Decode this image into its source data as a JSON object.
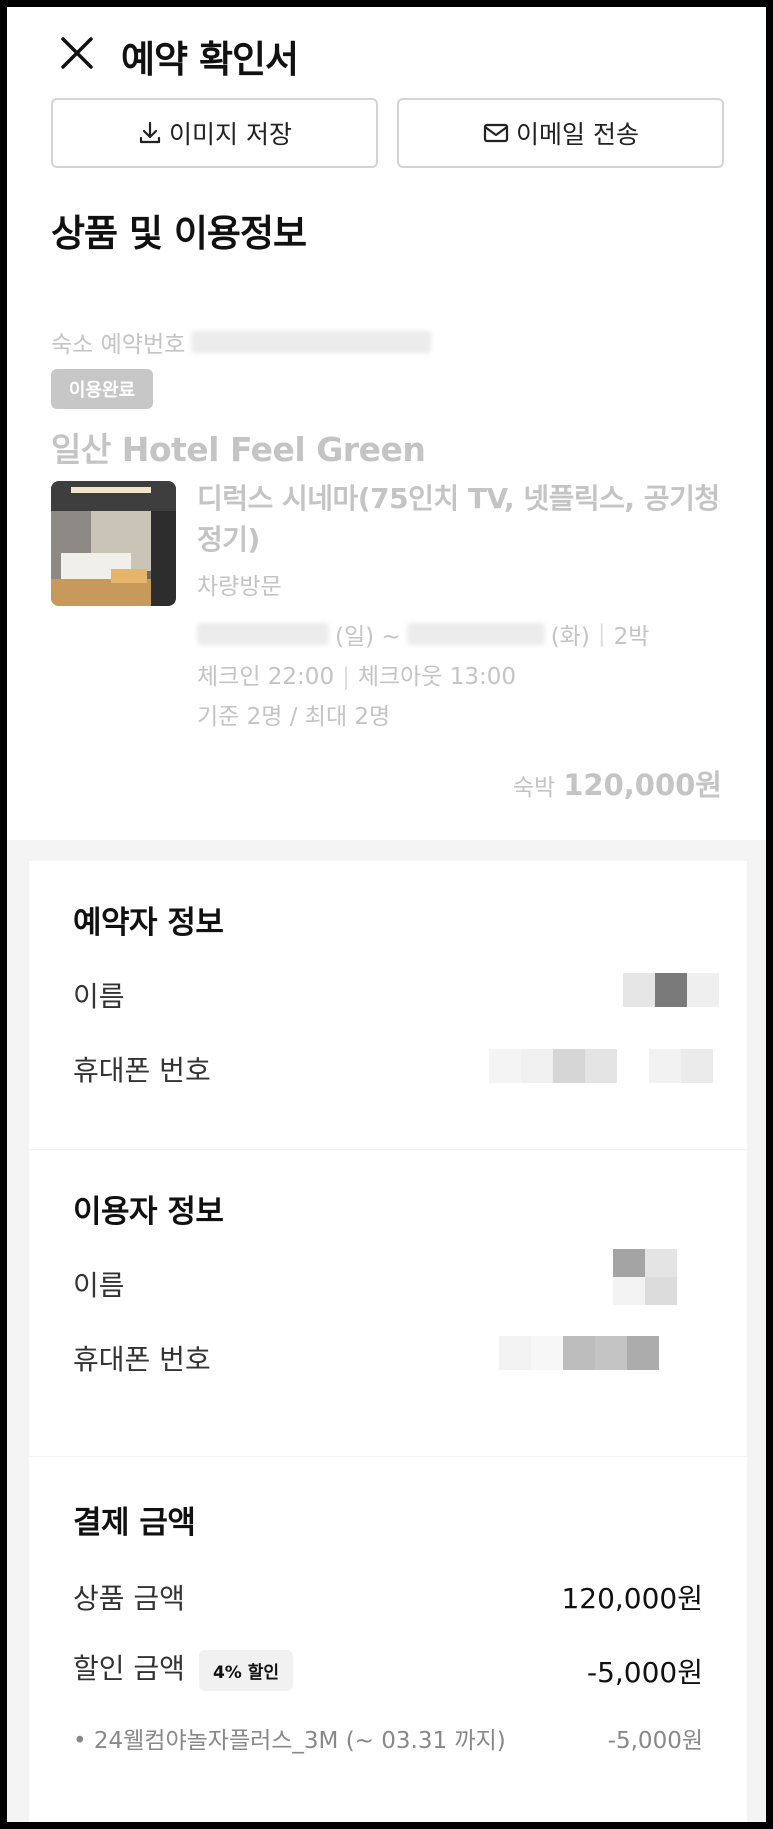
{
  "header": {
    "title": "예약 확인서"
  },
  "actions": {
    "save_label": "이미지 저장",
    "email_label": "이메일 전송"
  },
  "product": {
    "section_title": "상품 및 이용정보",
    "reservation_label": "숙소 예약번호",
    "status_badge": "이용완료",
    "hotel_name": "일산 Hotel Feel Green",
    "room_name": "디럭스 시네마(75인치 TV, 넷플릭스, 공기청정기)",
    "visit_type": "차량방문",
    "checkin_day": "(일) ~",
    "checkout_day": "(화)",
    "nights": "2박",
    "checkin": "체크인 22:00",
    "checkout": "체크아웃 13:00",
    "capacity": "기준 2명 / 최대 2명",
    "price_label": "숙박",
    "price": "120,000원"
  },
  "booker": {
    "title": "예약자 정보",
    "name_label": "이름",
    "phone_label": "휴대폰 번호"
  },
  "guest": {
    "title": "이용자 정보",
    "name_label": "이름",
    "phone_label": "휴대폰 번호"
  },
  "payment": {
    "title": "결제 금액",
    "product_label": "상품 금액",
    "product_amount": "120,000원",
    "discount_label": "할인 금액",
    "discount_badge": "4% 할인",
    "discount_amount": "-5,000원",
    "coupon_name": "• 24웰컴야놀자플러스_3M (~ 03.31 까지)",
    "coupon_amount": "-5,000원"
  },
  "colors": {
    "faded_text": "#c4c4c4",
    "badge_bg": "#c7c7c7",
    "divider": "#f4f4f4"
  },
  "icons": {
    "close": "close-icon",
    "download": "download-icon",
    "mail": "mail-icon"
  }
}
